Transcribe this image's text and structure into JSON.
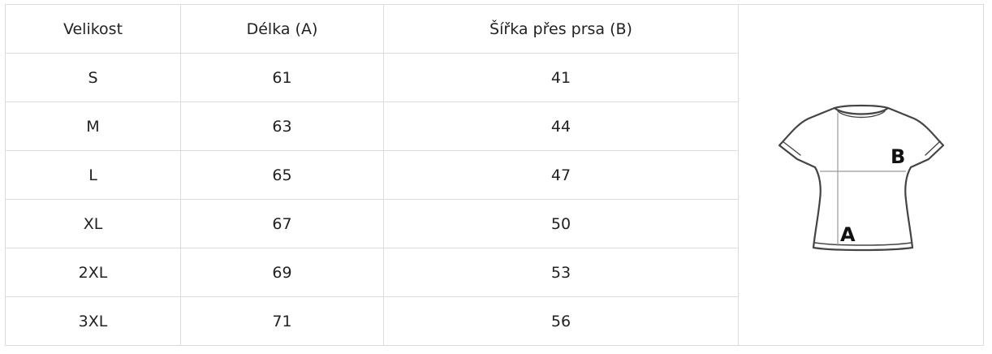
{
  "table": {
    "headers": [
      "Velikost",
      "Délka (A)",
      "Šířka přes prsa (B)"
    ],
    "rows": [
      {
        "size": "S",
        "length": "61",
        "width": "41"
      },
      {
        "size": "M",
        "length": "63",
        "width": "44"
      },
      {
        "size": "L",
        "length": "65",
        "width": "47"
      },
      {
        "size": "XL",
        "length": "67",
        "width": "50"
      },
      {
        "size": "2XL",
        "length": "69",
        "width": "53"
      },
      {
        "size": "3XL",
        "length": "71",
        "width": "56"
      }
    ]
  },
  "diagram": {
    "label_a": "A",
    "label_b": "B"
  }
}
